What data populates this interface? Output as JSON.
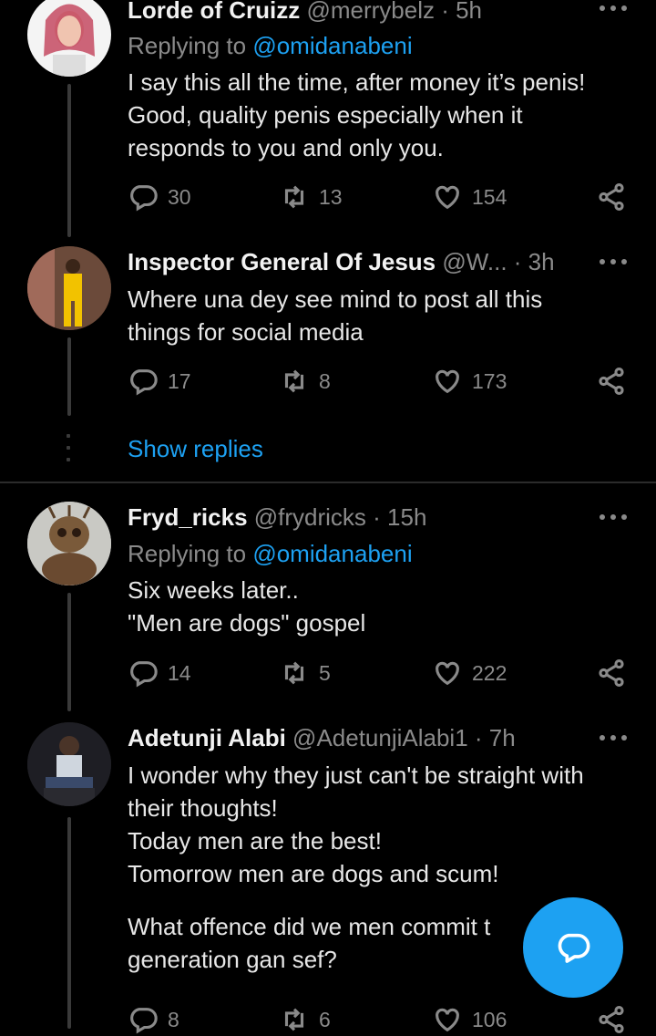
{
  "tweets": [
    {
      "name": "Lorde of Cruizz",
      "handle": "@merrybelz",
      "time": " · 5h",
      "replying_label": "Replying to ",
      "replying_handle": "@omidanabeni",
      "lines": [
        "I say this all the time, after money it’s penis!",
        "Good, quality penis especially when it",
        "responds to you and only you."
      ],
      "replies": "30",
      "retweets": "13",
      "likes": "154"
    },
    {
      "name": "Inspector General Of Jesus",
      "handle": "@W...",
      "time": " · 3h",
      "lines": [
        "Where una dey see mind to post all this",
        "things for social media"
      ],
      "replies": "17",
      "retweets": "8",
      "likes": "173"
    },
    {
      "name": "Fryd_ricks",
      "handle": "@frydricks",
      "time": " · 15h",
      "replying_label": "Replying to ",
      "replying_handle": "@omidanabeni",
      "lines": [
        "Six weeks later..",
        "\"Men are dogs\" gospel"
      ],
      "replies": "14",
      "retweets": "5",
      "likes": "222"
    },
    {
      "name": "Adetunji Alabi",
      "handle": "@AdetunjiAlabi1",
      "time": " · 7h",
      "lines": [
        "I wonder why they just can't be straight with",
        "their thoughts!",
        "Today men are the best!",
        "Tomorrow men are dogs and scum!",
        "",
        "What offence did we men commit t",
        "generation gan sef?"
      ],
      "replies": "8",
      "retweets": "6",
      "likes": "106"
    }
  ],
  "show_replies": "Show replies",
  "colors": {
    "accent": "#1da1f2",
    "background": "#000000",
    "muted": "#8a8a8a"
  },
  "icons": [
    "reply-icon",
    "retweet-icon",
    "like-icon",
    "share-icon",
    "more-icon",
    "compose-icon"
  ]
}
